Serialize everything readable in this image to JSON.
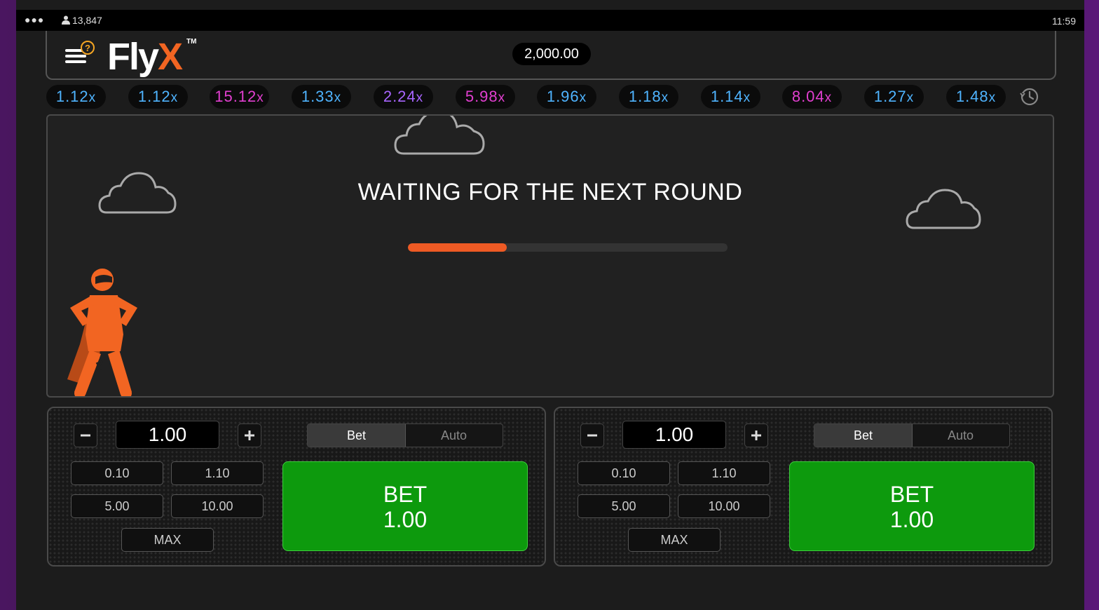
{
  "status_bar": {
    "menu_dots": "●●●",
    "player_count": "13,847",
    "time": "11:59"
  },
  "header": {
    "logo_text": "Fly",
    "logo_accent": "X",
    "logo_tm": "TM",
    "balance": "2,000.00"
  },
  "history": {
    "items": [
      {
        "value": "1.12",
        "suffix": "x",
        "color": "#4fb4ff"
      },
      {
        "value": "1.12",
        "suffix": "x",
        "color": "#4fb4ff"
      },
      {
        "value": "15.12",
        "suffix": "x",
        "color": "#e23fd0"
      },
      {
        "value": "1.33",
        "suffix": "x",
        "color": "#4fb4ff"
      },
      {
        "value": "2.24",
        "suffix": "x",
        "color": "#a865ff"
      },
      {
        "value": "5.98",
        "suffix": "x",
        "color": "#e23fd0"
      },
      {
        "value": "1.96",
        "suffix": "x",
        "color": "#4fb4ff"
      },
      {
        "value": "1.18",
        "suffix": "x",
        "color": "#4fb4ff"
      },
      {
        "value": "1.14",
        "suffix": "x",
        "color": "#4fb4ff"
      },
      {
        "value": "8.04",
        "suffix": "x",
        "color": "#e23fd0"
      },
      {
        "value": "1.27",
        "suffix": "x",
        "color": "#4fb4ff"
      },
      {
        "value": "1.48",
        "suffix": "x",
        "color": "#4fb4ff"
      }
    ]
  },
  "game": {
    "status_text": "WAITING FOR THE NEXT ROUND",
    "progress": 0.31,
    "progress_color": "#ee5a24",
    "hero_color": "#f26522"
  },
  "bet_panels": [
    {
      "amount": "1.00",
      "mode_bet": "Bet",
      "mode_auto": "Auto",
      "quick_amounts": [
        "0.10",
        "1.10",
        "5.00",
        "10.00"
      ],
      "max_label": "MAX",
      "bet_label": "BET",
      "bet_amount": "1.00"
    },
    {
      "amount": "1.00",
      "mode_bet": "Bet",
      "mode_auto": "Auto",
      "quick_amounts": [
        "0.10",
        "1.10",
        "5.00",
        "10.00"
      ],
      "max_label": "MAX",
      "bet_label": "BET",
      "bet_amount": "1.00"
    }
  ],
  "colors": {
    "accent": "#f26522",
    "bet_green": "#0d9a0d"
  }
}
